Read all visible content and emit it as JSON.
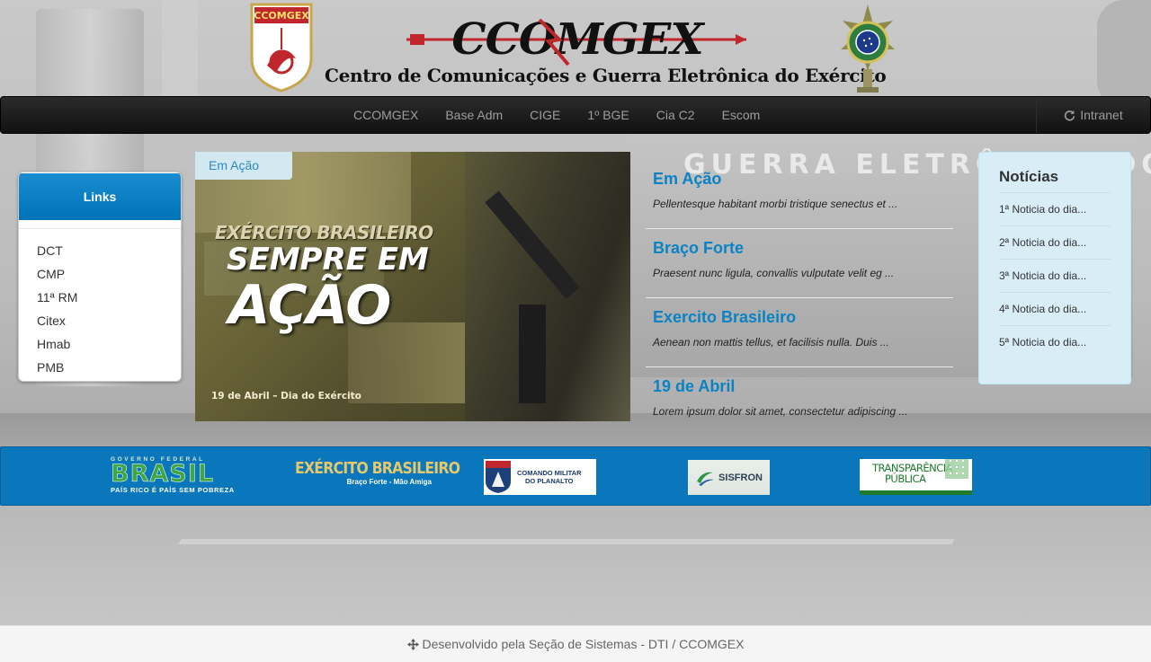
{
  "header": {
    "emblem_left_label": "CCOMGEX",
    "logo_title": "CCOMGEX",
    "logo_subtitle": "Centro de Comunicações e Guerra Eletrônica do Exército"
  },
  "background": {
    "building_text": "GUERRA ELETRÔNICA DO EXÉRCITO"
  },
  "navbar": {
    "items": [
      {
        "label": "CCOMGEX"
      },
      {
        "label": "Base Adm"
      },
      {
        "label": "CIGE"
      },
      {
        "label": "1º BGE"
      },
      {
        "label": "Cia C2"
      },
      {
        "label": "Escom"
      }
    ],
    "right": {
      "icon": "refresh-icon",
      "label": "Intranet"
    }
  },
  "links": {
    "title": "Links",
    "items": [
      "DCT",
      "CMP",
      "11ª RM",
      "Citex",
      "Hmab",
      "PMB"
    ]
  },
  "carousel": {
    "tag": "Em Ação",
    "line1": "EXÉRCITO BRASILEIRO",
    "line2": "SEMPRE EM",
    "line3": "AÇÃO",
    "date_text": "19 de Abril – Dia do Exército"
  },
  "headlines": [
    {
      "title": "Em Ação",
      "text": "Pellentesque habitant morbi tristique senectus et ..."
    },
    {
      "title": "Braço Forte",
      "text": "Praesent nunc ligula, convallis vulputate velit eg ..."
    },
    {
      "title": "Exercito Brasileiro",
      "text": "Aenean non mattis tellus, et facilisis nulla. Duis ..."
    },
    {
      "title": "19 de Abril",
      "text": "Lorem ipsum dolor sit amet, consectetur adipiscing ..."
    }
  ],
  "news": {
    "title": "Notícias",
    "items": [
      "1ª Noticia do dia...",
      "2ª Noticia do dia...",
      "3ª Noticia do dia...",
      "4ª Noticia do dia...",
      "5ª Noticia do dia..."
    ]
  },
  "partners": {
    "brasil": {
      "small": "GOVERNO FEDERAL",
      "big": "BRASIL",
      "tag": "PAÍS RICO É PAÍS SEM POBREZA"
    },
    "exercito": {
      "big": "EXÉRCITO BRASILEIRO",
      "tag": "Braço Forte - Mão Amiga"
    },
    "cmp": {
      "line1": "COMANDO MILITAR",
      "line2": "DO PLANALTO"
    },
    "sisfron": {
      "label": "SISFRON"
    },
    "transparencia": {
      "line1": "TRANSPARÊNCIA",
      "line2": "PÚBLICA"
    }
  },
  "footer": {
    "icon": "move-icon",
    "text": "Desenvolvido pela Seção de Sistemas - DTI / CCOMGEX"
  },
  "colors": {
    "accent_blue": "#0a83c5",
    "partners_bar": "#0a76bb",
    "navbar": "#1a1a1a",
    "news_panel": "#d9edf7"
  }
}
